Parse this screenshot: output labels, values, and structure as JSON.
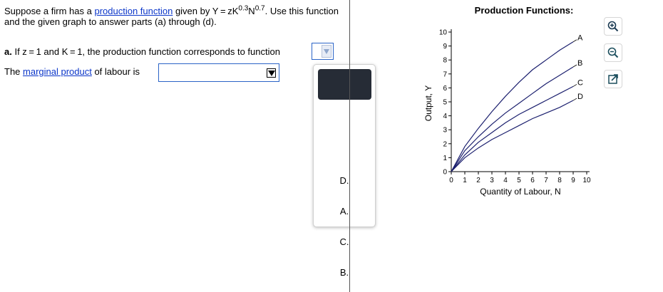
{
  "question": {
    "intro_1": "Suppose a firm has a ",
    "link_1": "production function",
    "intro_2": " given by Y = zK",
    "exp_k": "0.3",
    "n_var": "N",
    "exp_n": "0.7",
    "intro_3": ". Use this function and the given graph to answer parts (a) through (d)."
  },
  "part_a": {
    "label": "a.",
    "text": " If z = 1 and K = 1, the production function corresponds to function",
    "mp_text_1": "The ",
    "mp_link": "marginal product",
    "mp_text_2": " of labour is"
  },
  "dropdown": {
    "options": [
      "D.",
      "A.",
      "C.",
      "B."
    ]
  },
  "colors": {
    "curve": "#1b1f6e",
    "link": "#0b36c9",
    "selected": "#262c36"
  },
  "icons": [
    "zoom-in-icon",
    "zoom-out-icon",
    "popout-icon"
  ],
  "chart_data": {
    "type": "line",
    "title": "Production Functions:",
    "xlabel": "Quantity of Labour, N",
    "ylabel": "Output, Y",
    "xlim": [
      0,
      10
    ],
    "ylim": [
      0,
      10
    ],
    "xticks": [
      "0",
      "1",
      "2",
      "3",
      "4",
      "5",
      "6",
      "7",
      "8",
      "9",
      "10"
    ],
    "yticks": [
      "0",
      "1",
      "2",
      "3",
      "4",
      "5",
      "6",
      "7",
      "8",
      "9",
      "10"
    ],
    "series": [
      {
        "name": "A",
        "x": [
          0,
          1,
          2,
          3,
          4,
          5,
          6,
          7,
          8,
          9
        ],
        "y": [
          0,
          1.8,
          3.1,
          4.3,
          5.4,
          6.4,
          7.3,
          8.0,
          8.7,
          9.3
        ]
      },
      {
        "name": "B",
        "x": [
          0,
          1,
          2,
          3,
          4,
          5,
          6,
          7,
          8,
          9
        ],
        "y": [
          0,
          1.5,
          2.5,
          3.4,
          4.2,
          4.9,
          5.6,
          6.3,
          6.9,
          7.5
        ]
      },
      {
        "name": "C",
        "x": [
          0,
          1,
          2,
          3,
          4,
          5,
          6,
          7,
          8,
          9
        ],
        "y": [
          0,
          1.2,
          2.1,
          2.8,
          3.5,
          4.1,
          4.6,
          5.1,
          5.6,
          6.1
        ]
      },
      {
        "name": "D",
        "x": [
          0,
          1,
          2,
          3,
          4,
          5,
          6,
          7,
          8,
          9
        ],
        "y": [
          0,
          1.0,
          1.7,
          2.3,
          2.8,
          3.3,
          3.8,
          4.2,
          4.6,
          5.1
        ]
      }
    ]
  }
}
